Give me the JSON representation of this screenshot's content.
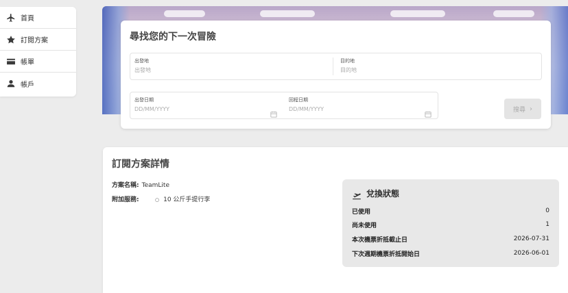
{
  "sidebar": {
    "items": [
      {
        "label": "首頁",
        "icon": "airplane-icon"
      },
      {
        "label": "訂閱方案",
        "icon": "star-icon"
      },
      {
        "label": "帳單",
        "icon": "card-icon"
      },
      {
        "label": "帳戶",
        "icon": "person-icon"
      }
    ]
  },
  "search": {
    "title": "尋找您的下一次冒險",
    "origin": {
      "label": "出發地",
      "placeholder": "出發地"
    },
    "destination": {
      "label": "目的地",
      "placeholder": "目的地"
    },
    "depart_date": {
      "label": "出發日期",
      "placeholder": "DD/MM/YYYY"
    },
    "return_date": {
      "label": "回程日期",
      "placeholder": "DD/MM/YYYY"
    },
    "button_label": "搜尋",
    "button_icon": "chevron-right-icon"
  },
  "plan": {
    "title": "訂閱方案詳情",
    "name_key": "方案名稱:",
    "name_value": "TeamLite",
    "addons_key": "附加服務:",
    "addons": [
      "10 公斤手提行李"
    ]
  },
  "status": {
    "title": "兌換狀態",
    "icon": "plane-departure-icon",
    "rows": [
      {
        "label": "已使用",
        "value": "0"
      },
      {
        "label": "尚未使用",
        "value": "1"
      },
      {
        "label": "本次機票折抵截止日",
        "value": "2026-07-31"
      },
      {
        "label": "下次週期機票折抵開始日",
        "value": "2026-06-01"
      }
    ]
  },
  "colors": {
    "background": "#ececec",
    "card": "#ffffff",
    "status_box": "#e8e8e8",
    "button_disabled": "#e4e4e4"
  }
}
